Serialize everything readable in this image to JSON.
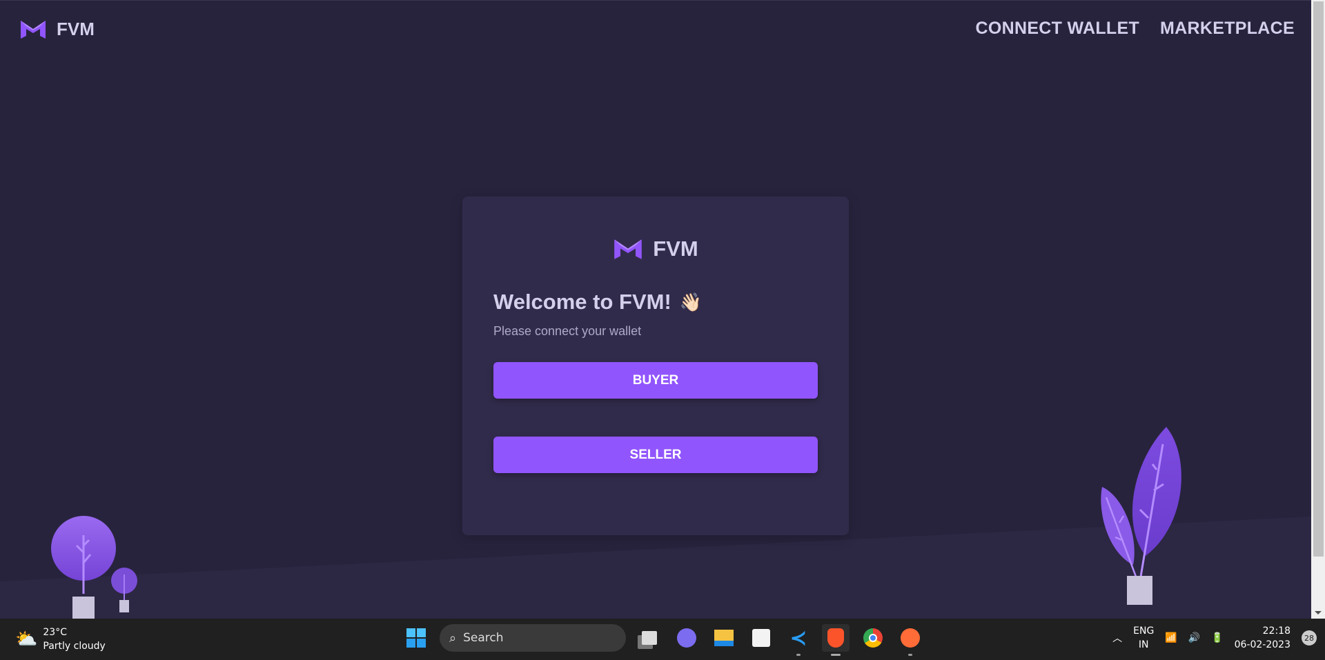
{
  "header": {
    "brand": "FVM",
    "nav": [
      {
        "label": "CONNECT WALLET"
      },
      {
        "label": "MARKETPLACE"
      }
    ]
  },
  "card": {
    "brand": "FVM",
    "title": "Welcome to FVM!",
    "emoji": "👋🏻",
    "subtitle": "Please connect your wallet",
    "buttons": {
      "buyer": "BUYER",
      "seller": "SELLER"
    }
  },
  "colors": {
    "background": "#27233d",
    "card": "#312b4b",
    "accent": "#9155fd",
    "text": "#d4d0ec"
  },
  "taskbar": {
    "weather": {
      "temp": "23°C",
      "condition": "Partly cloudy"
    },
    "search_label": "Search",
    "lang": "ENG",
    "region": "IN",
    "time": "22:18",
    "date": "06-02-2023",
    "notifications": "28",
    "apps": [
      "task-view",
      "chat",
      "file-explorer",
      "microsoft-store",
      "vscode",
      "brave",
      "chrome",
      "postman"
    ]
  }
}
